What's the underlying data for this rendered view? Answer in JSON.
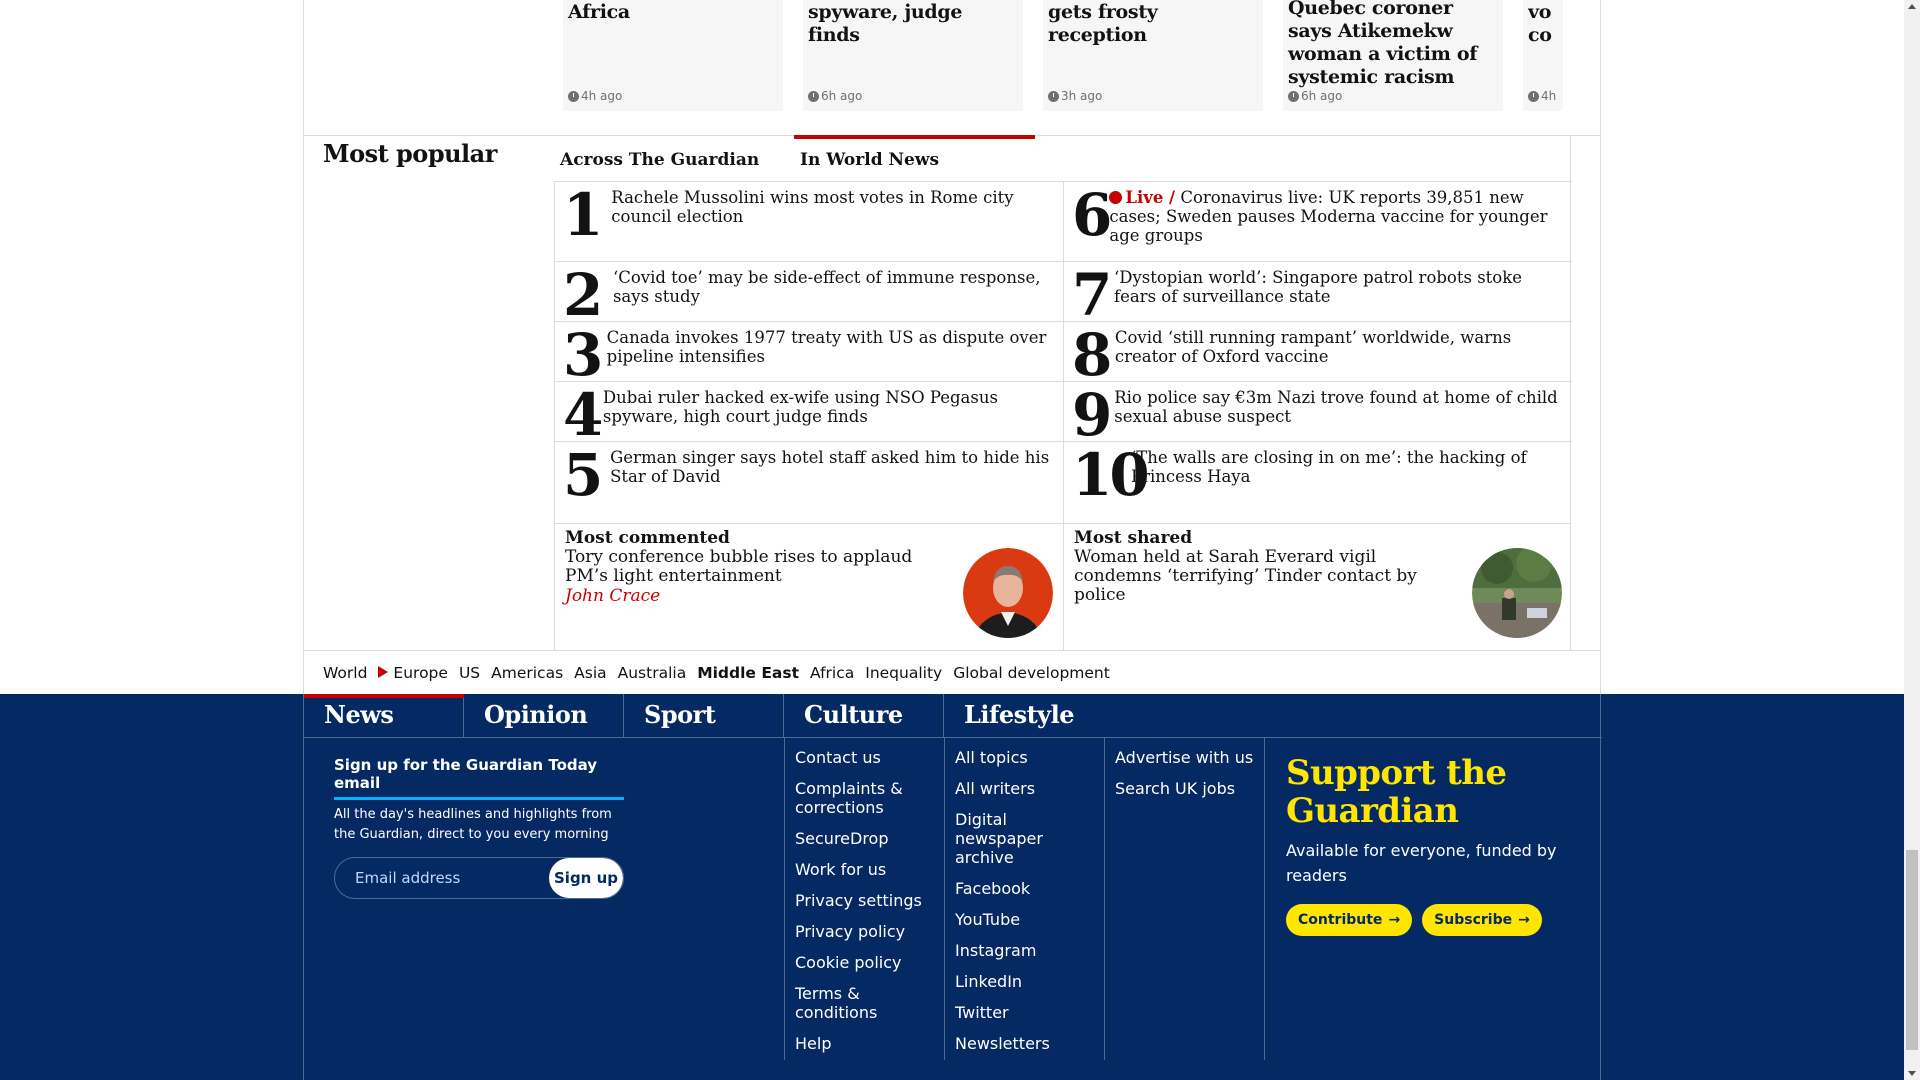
{
  "carousel": {
    "cards": [
      {
        "headline": "first vaccine in Africa",
        "age": "4h ago"
      },
      {
        "headline": "using NSO Pegasus spyware, judge finds",
        "age": "6h ago"
      },
      {
        "headline": "conference speech gets frosty reception",
        "age": "3h ago"
      },
      {
        "headline": "Quebec coroner says Atikemekw woman a victim of systemic racism",
        "age": "6h ago"
      },
      {
        "headline": "vo co",
        "age": "4h"
      }
    ]
  },
  "most_popular": {
    "title": "Most popular",
    "tabs": [
      {
        "label": "Across The Guardian"
      },
      {
        "label": "In World News"
      }
    ],
    "items": [
      {
        "num": "1",
        "text": "Rachele Mussolini wins most votes in Rome city council election"
      },
      {
        "num": "2",
        "text": "‘Covid toe’ may be side-effect of immune response, says study"
      },
      {
        "num": "3",
        "text": "Canada invokes 1977 treaty with US as dispute over pipeline intensifies"
      },
      {
        "num": "4",
        "text": "Dubai ruler hacked ex-wife using NSO Pegasus spyware, high court judge finds"
      },
      {
        "num": "5",
        "text": "German singer says hotel staff asked him to hide his Star of David"
      },
      {
        "num": "6",
        "live": "Live /",
        "text": "Coronavirus live: UK reports 39,851 new cases; Sweden pauses Moderna vaccine for younger age groups"
      },
      {
        "num": "7",
        "text": "‘Dystopian world’: Singapore patrol robots stoke fears of surveillance state"
      },
      {
        "num": "8",
        "text": "Covid ‘still running rampant’ worldwide, warns creator of Oxford vaccine"
      },
      {
        "num": "9",
        "text": "Rio police say €3m Nazi trove found at home of child sexual abuse suspect"
      },
      {
        "num": "10",
        "text": "‘The walls are closing in on me’: the hacking of Princess Haya"
      }
    ],
    "most_commented": {
      "label": "Most commented",
      "text": "Tory conference bubble rises to applaud PM’s light entertainment",
      "byline": "John Crace"
    },
    "most_shared": {
      "label": "Most shared",
      "text": "Woman held at Sarah Everard vigil condemns ‘terrifying’ Tinder contact by police"
    }
  },
  "subnav": {
    "items": [
      "World",
      "Europe",
      "US",
      "Americas",
      "Asia",
      "Australia",
      "Middle East",
      "Africa",
      "Inequality",
      "Global development"
    ]
  },
  "footer": {
    "pillars": [
      "News",
      "Opinion",
      "Sport",
      "Culture",
      "Lifestyle"
    ],
    "signup": {
      "heading": "Sign up for the Guardian Today email",
      "desc": "All the day's headlines and highlights from the Guardian, direct to you every morning",
      "placeholder": "Email address",
      "button": "Sign up"
    },
    "col1": [
      "Contact us",
      "Complaints & corrections",
      "SecureDrop",
      "Work for us",
      "Privacy settings",
      "Privacy policy",
      "Cookie policy",
      "Terms & conditions",
      "Help"
    ],
    "col2": [
      "All topics",
      "All writers",
      "Digital newspaper archive",
      "Facebook",
      "YouTube",
      "Instagram",
      "LinkedIn",
      "Twitter",
      "Newsletters"
    ],
    "col3": [
      "Advertise with us",
      "Search UK jobs"
    ],
    "support": {
      "title": "Support the Guardian",
      "subtitle": "Available for everyone, funded by readers",
      "contribute": "Contribute",
      "subscribe": "Subscribe"
    }
  },
  "colors": {
    "brand_blue": "#052962",
    "live_red": "#c70000",
    "support_yellow": "#ffe500"
  }
}
